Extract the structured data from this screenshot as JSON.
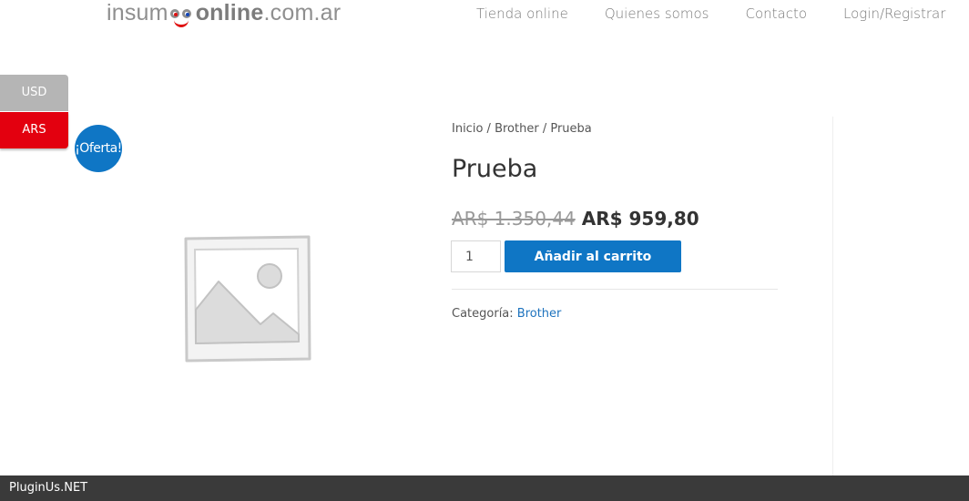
{
  "header": {
    "logo": {
      "part1": "insum",
      "part2": "online",
      "part3": ".com.ar"
    },
    "nav": [
      {
        "label": "Tienda online"
      },
      {
        "label": "Quienes somos"
      },
      {
        "label": "Contacto"
      },
      {
        "label": "Login/Registrar"
      }
    ]
  },
  "currency": {
    "options": [
      {
        "label": "USD",
        "color": "#b5b5b5"
      },
      {
        "label": "ARS",
        "color": "#e3000f",
        "selected": true
      }
    ]
  },
  "product": {
    "sale_badge": "¡Oferta!",
    "image_icon": "image-placeholder-icon",
    "breadcrumb": {
      "home": "Inicio",
      "sep": " / ",
      "category": "Brother",
      "current": "Prueba"
    },
    "title": "Prueba",
    "price_old": "AR$ 1.350,44",
    "price_new": "AR$ 959,80",
    "quantity": "1",
    "add_to_cart": "Añadir al carrito",
    "category_label": "Categoría: ",
    "category_value": "Brother",
    "accent_color": "#0f76c5"
  },
  "footer": {
    "text": "PluginUs.NET"
  }
}
